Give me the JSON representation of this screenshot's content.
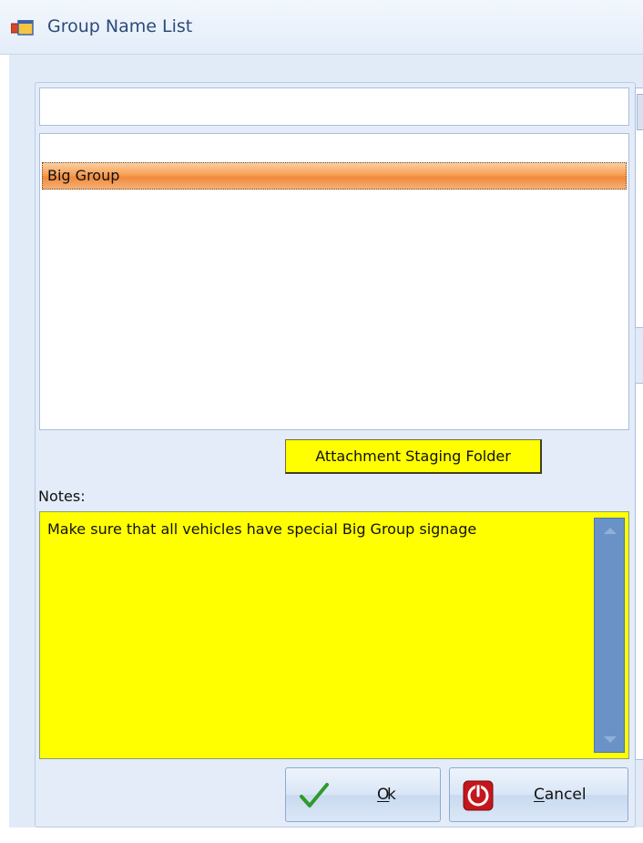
{
  "window": {
    "title": "Group Name List",
    "icon": "window-app-icon"
  },
  "search": {
    "value": "",
    "placeholder": ""
  },
  "group_list": {
    "items": [
      "Big Group"
    ],
    "selected_index": 0
  },
  "attachment_button": {
    "label": "Attachment Staging Folder"
  },
  "notes": {
    "label": "Notes:",
    "text": "Make sure that all vehicles have special Big Group signage"
  },
  "buttons": {
    "ok": {
      "mnemonic": "O",
      "rest": "k",
      "icon": "checkmark-icon"
    },
    "cancel": {
      "mnemonic": "C",
      "rest": "ancel",
      "icon": "stop-icon"
    }
  },
  "colors": {
    "selection": "#f08a3c",
    "notes_background": "#ffff00",
    "attachment_button_background": "#ffff00",
    "title_text": "#2e4a78"
  }
}
